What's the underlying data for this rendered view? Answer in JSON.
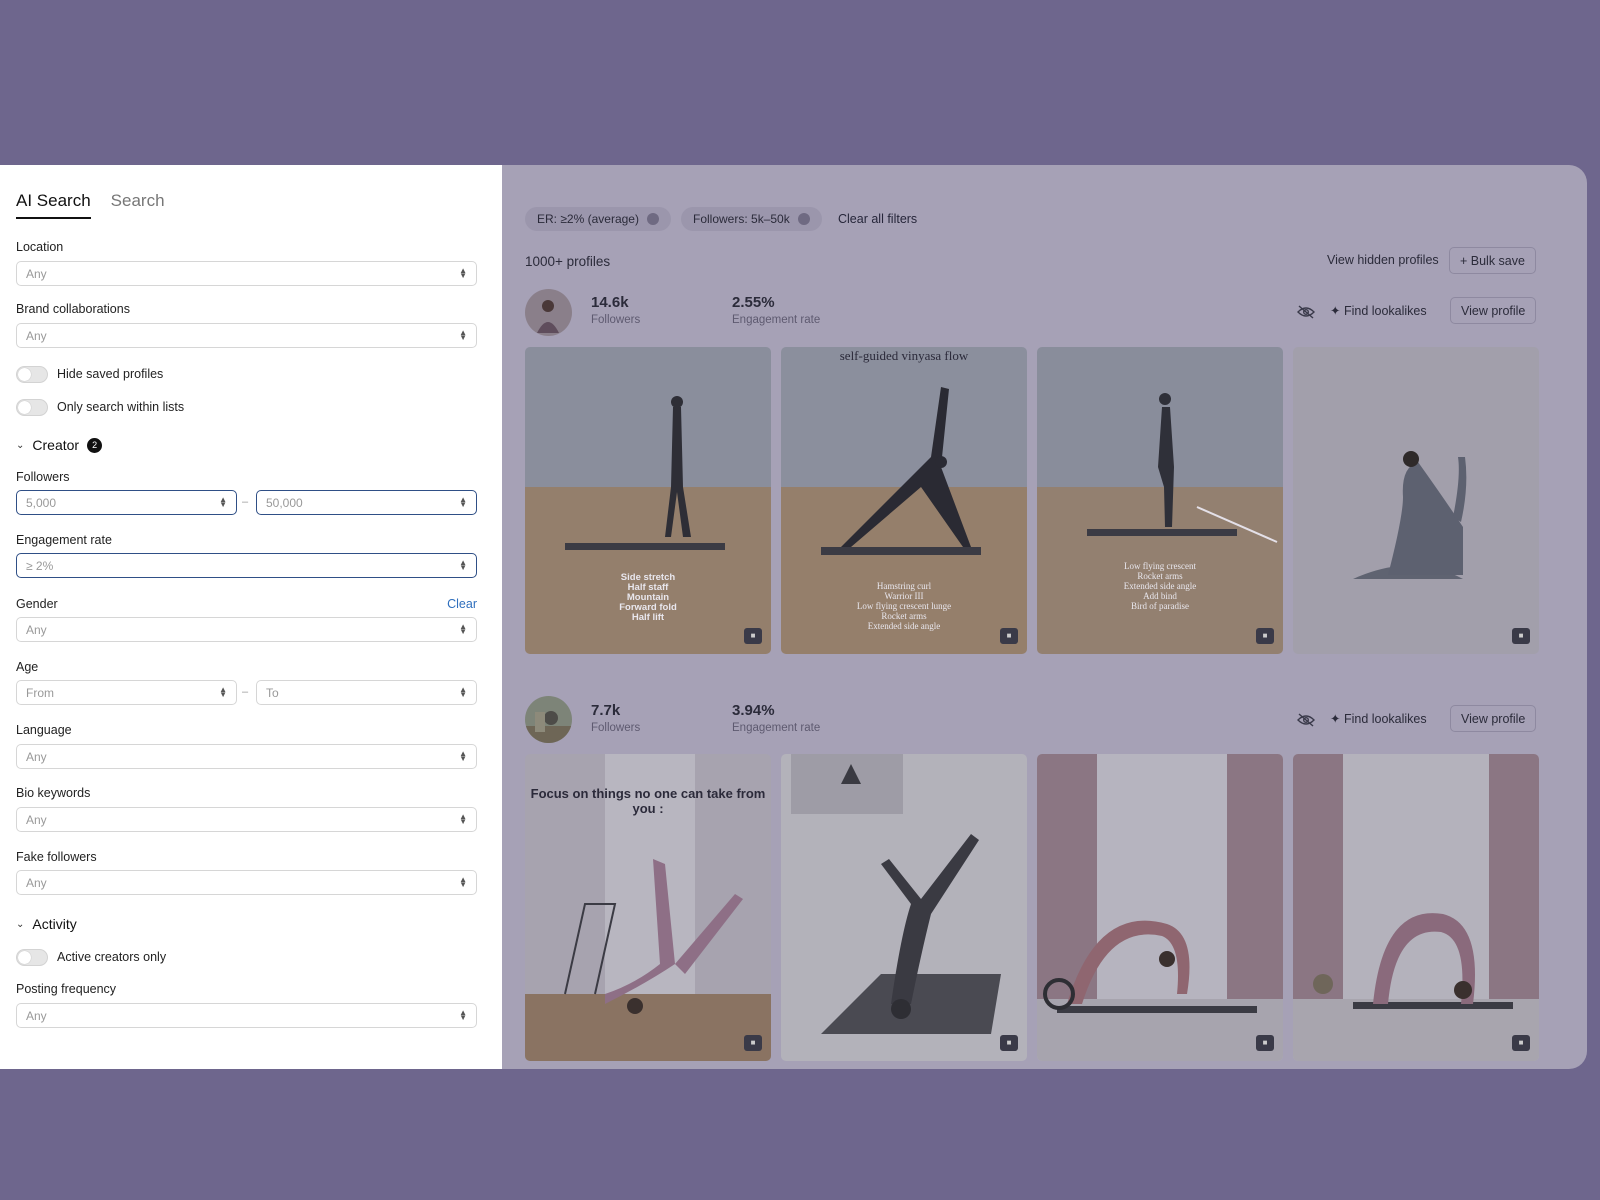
{
  "tabs": [
    {
      "label": "AI Search"
    },
    {
      "label": "Search"
    }
  ],
  "filters": {
    "location": {
      "label": "Location",
      "value": "Any"
    },
    "brand": {
      "label": "Brand collaborations",
      "value": "Any"
    },
    "hide_saved": {
      "label": "Hide saved profiles"
    },
    "only_lists": {
      "label": "Only search within lists"
    },
    "creator_section": {
      "label": "Creator",
      "badge": "2"
    },
    "followers": {
      "label": "Followers",
      "min": "5,000",
      "sep": "–",
      "max": "50,000"
    },
    "engagement": {
      "label": "Engagement rate",
      "value": "≥ 2%"
    },
    "gender": {
      "label": "Gender",
      "clear": "Clear",
      "value": "Any"
    },
    "age": {
      "label": "Age",
      "from": "From",
      "sep": "–",
      "to": "To"
    },
    "language": {
      "label": "Language",
      "value": "Any"
    },
    "bio": {
      "label": "Bio keywords",
      "value": "Any"
    },
    "fake": {
      "label": "Fake followers",
      "value": "Any"
    },
    "activity_section": {
      "label": "Activity"
    },
    "active_only": {
      "label": "Active creators only"
    },
    "posting": {
      "label": "Posting frequency",
      "value": "Any"
    }
  },
  "chips": [
    {
      "label": "ER: ≥2% (average)"
    },
    {
      "label": "Followers: 5k–50k"
    }
  ],
  "clear_all": "Clear all filters",
  "results": {
    "count": "1000+ profiles",
    "view_hidden": "View hidden profiles",
    "bulk_save": "+ Bulk save"
  },
  "profiles": [
    {
      "followers": "14.6k",
      "followers_label": "Followers",
      "er": "2.55%",
      "er_label": "Engagement rate",
      "lookalikes": "Find lookalikes",
      "view": "View profile",
      "posts": [
        {
          "lines": [
            "Side stretch",
            "Half staff",
            "Mountain",
            "Forward fold",
            "Half lift"
          ]
        },
        {
          "title": "self-guided vinyasa flow",
          "lines": [
            "Hamstring curl",
            "Warrior III",
            "Low flying crescent lunge",
            "Rocket arms",
            "Extended side angle"
          ]
        },
        {
          "lines": [
            "Low flying crescent",
            "Rocket arms",
            "Extended side angle",
            "Add bind",
            "Bird of paradise"
          ]
        },
        {}
      ]
    },
    {
      "followers": "7.7k",
      "followers_label": "Followers",
      "er": "3.94%",
      "er_label": "Engagement rate",
      "lookalikes": "Find lookalikes",
      "view": "View profile",
      "posts": [
        {
          "title": "Focus on things no one can take from you :"
        },
        {},
        {},
        {}
      ]
    }
  ],
  "icons": {
    "video": "video-icon",
    "hide": "eye-off-icon",
    "sparkle": "sparkle-icon"
  }
}
